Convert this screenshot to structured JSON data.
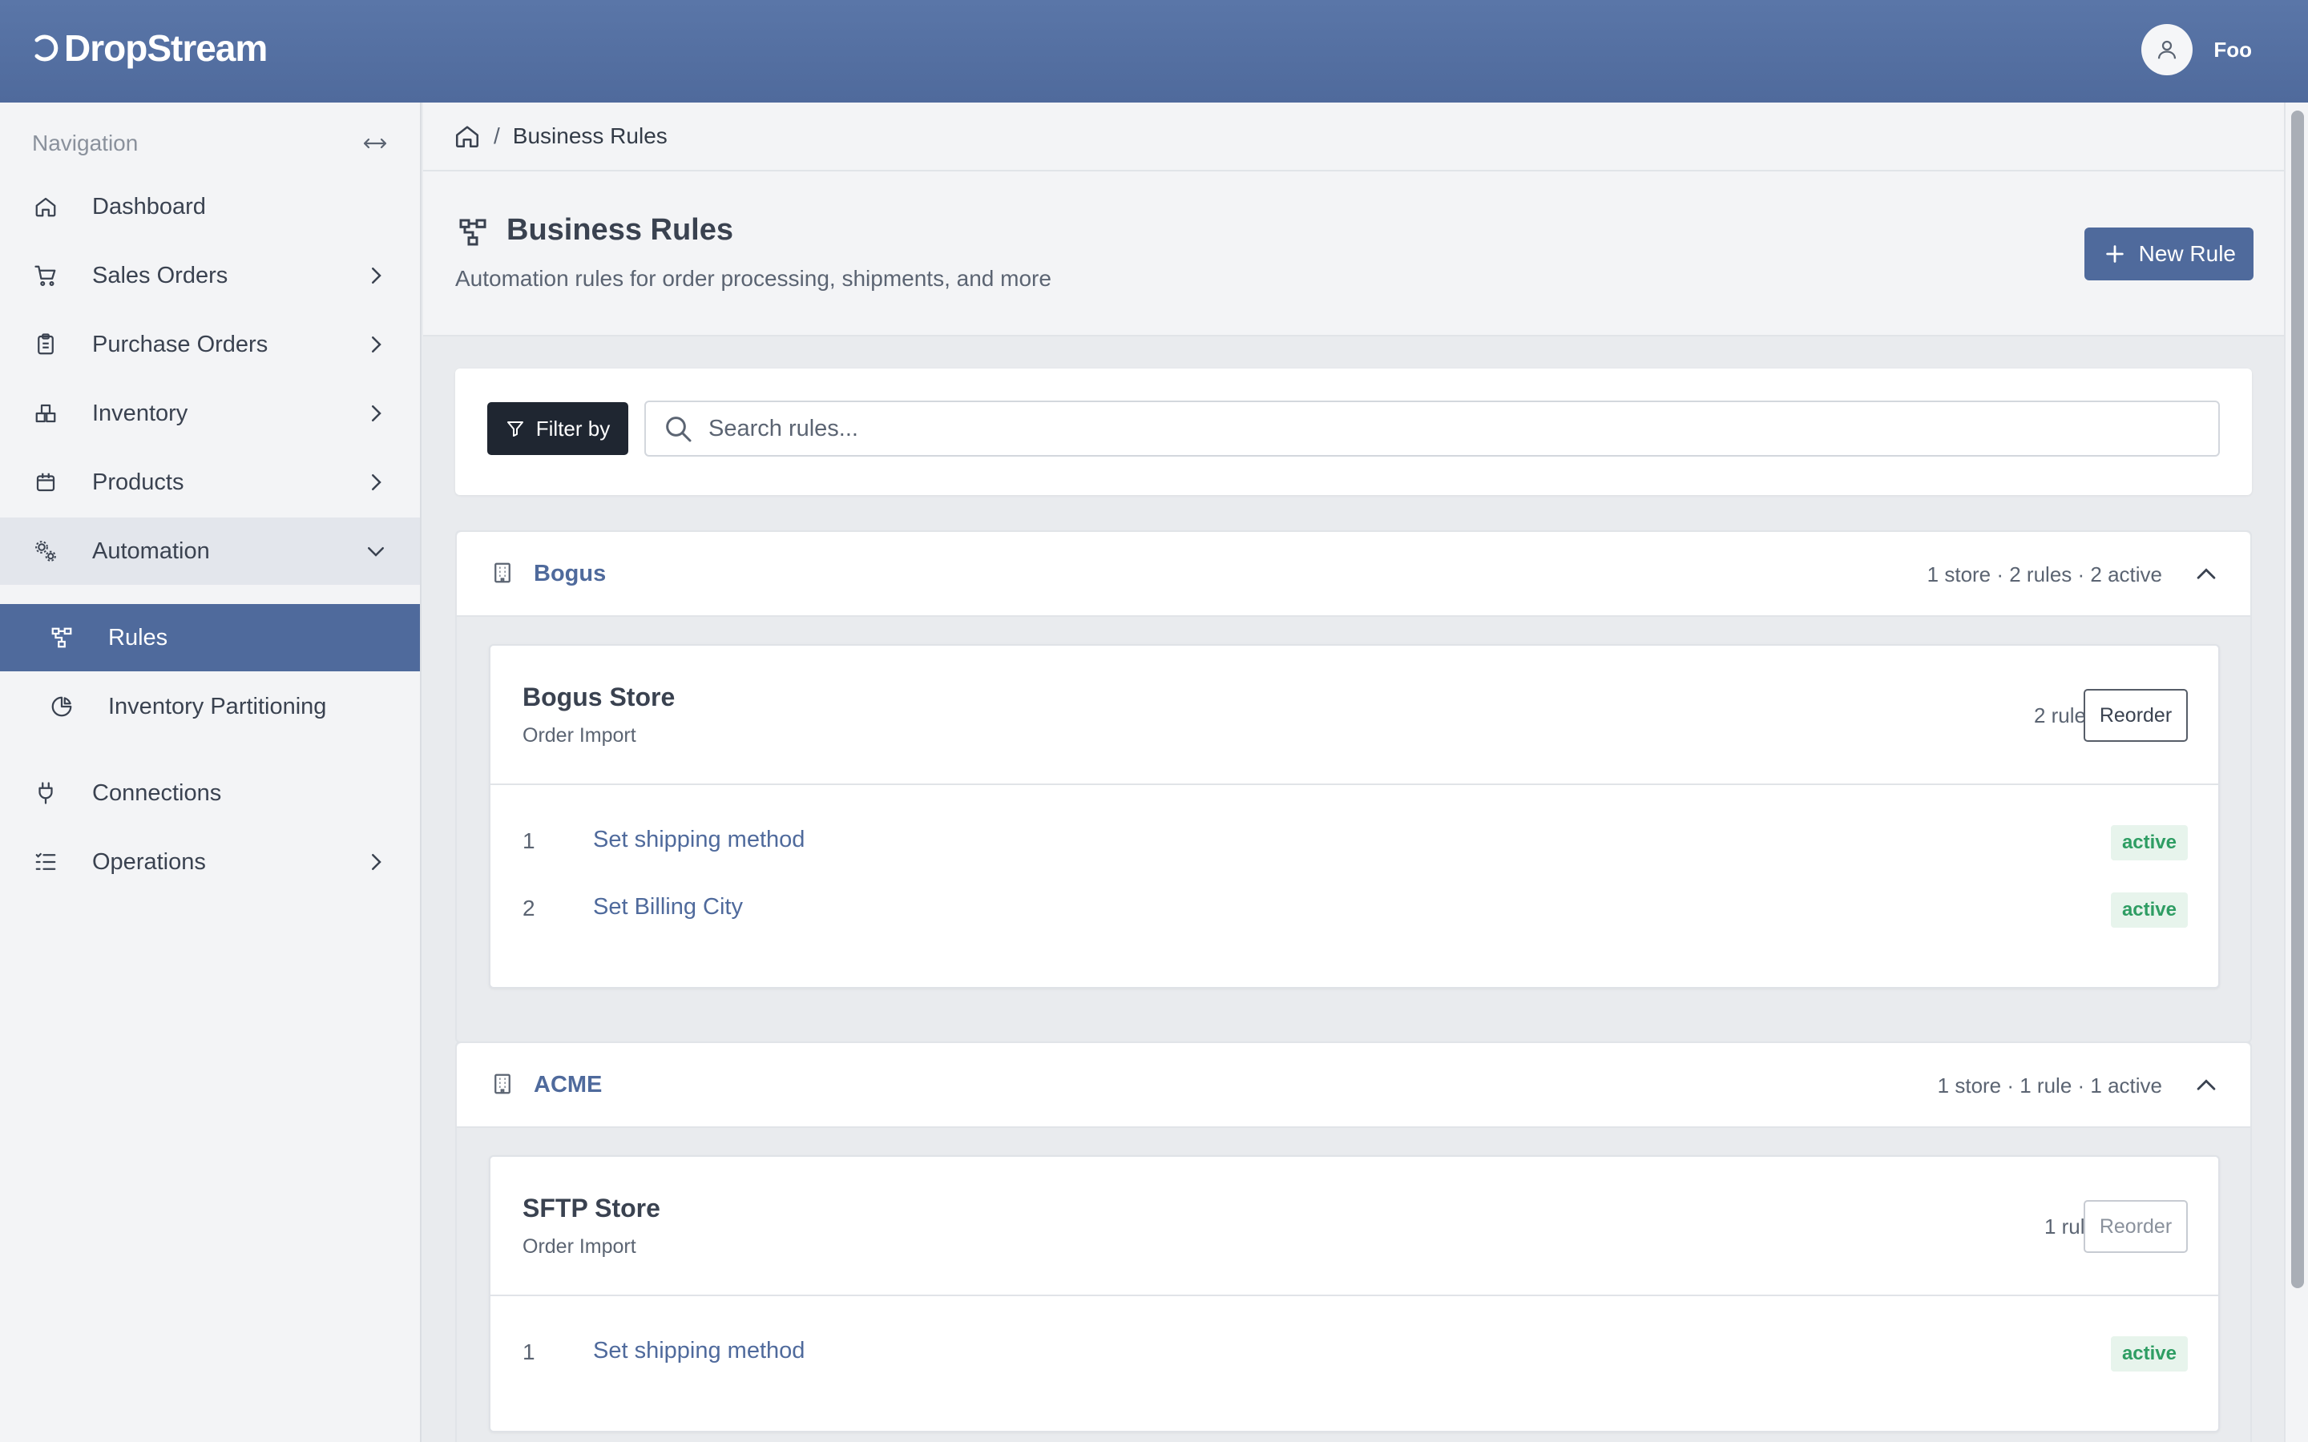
{
  "app": {
    "brand": "DropStream",
    "user_name": "Foo"
  },
  "sidebar": {
    "title": "Navigation",
    "items": [
      {
        "label": "Dashboard",
        "icon": "home-icon"
      },
      {
        "label": "Sales Orders",
        "icon": "cart-icon"
      },
      {
        "label": "Purchase Orders",
        "icon": "clipboard-icon"
      },
      {
        "label": "Inventory",
        "icon": "boxes-icon"
      },
      {
        "label": "Products",
        "icon": "package-icon"
      },
      {
        "label": "Automation",
        "icon": "gears-icon"
      },
      {
        "label": "Connections",
        "icon": "plug-icon"
      },
      {
        "label": "Operations",
        "icon": "list-check-icon"
      }
    ],
    "automation_sub": [
      {
        "label": "Rules",
        "icon": "rules-icon"
      },
      {
        "label": "Inventory Partitioning",
        "icon": "pie-chart-icon"
      }
    ]
  },
  "breadcrumb": {
    "separator": "/",
    "current": "Business Rules"
  },
  "page": {
    "title": "Business Rules",
    "subtitle": "Automation rules for order processing, shipments, and more",
    "new_rule_label": "New Rule"
  },
  "filter": {
    "button_label": "Filter by",
    "search_placeholder": "Search rules..."
  },
  "groups": [
    {
      "name": "Bogus",
      "meta": "1 store · 2 rules · 2 active",
      "store": {
        "name": "Bogus Store",
        "type": "Order Import",
        "count": "2 rules",
        "reorder_label": "Reorder",
        "rules": [
          {
            "num": "1",
            "name": "Set shipping method",
            "status": "active"
          },
          {
            "num": "2",
            "name": "Set Billing City",
            "status": "active"
          }
        ]
      }
    },
    {
      "name": "ACME",
      "meta": "1 store · 1 rule · 1 active",
      "store": {
        "name": "SFTP Store",
        "type": "Order Import",
        "count": "1 rule",
        "reorder_label": "Reorder",
        "rules": [
          {
            "num": "1",
            "name": "Set shipping method",
            "status": "active"
          }
        ]
      }
    }
  ],
  "colors": {
    "brand": "#4f6a9c",
    "active_badge_text": "#2e9d63",
    "active_badge_bg": "#e7f4ec"
  }
}
